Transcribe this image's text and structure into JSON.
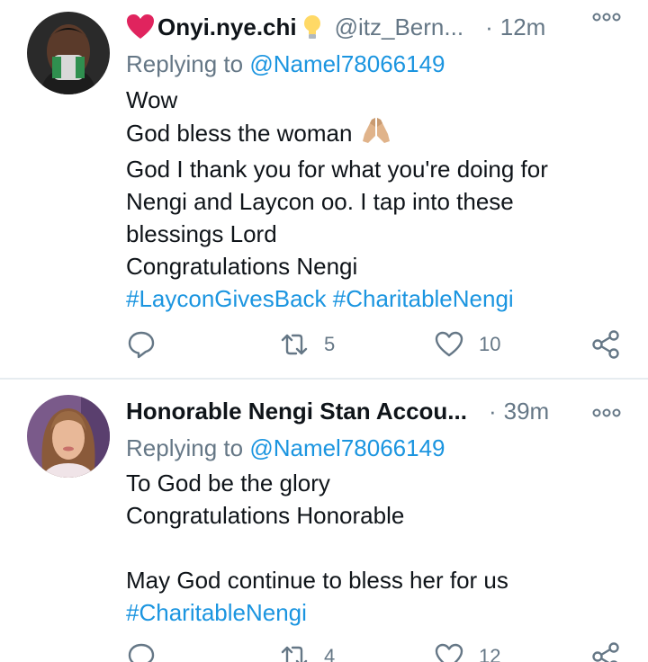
{
  "tweets": [
    {
      "display_name": "Onyi.nye.chi",
      "handle": "@itz_Bern...",
      "time": "12m",
      "replying_prefix": "Replying to ",
      "replying_to": "@Namel78066149",
      "lines": [
        "Wow",
        "God bless the woman",
        "God I thank you for what you're doing for",
        "Nengi and Laycon oo. I tap into these",
        "blessings Lord",
        "Congratulations Nengi"
      ],
      "hashtags": [
        "#LayconGivesBack",
        "#CharitableNengi"
      ],
      "replies": "",
      "retweets": "5",
      "likes": "10"
    },
    {
      "display_name": "Honorable Nengi Stan Accou...",
      "time": "39m",
      "replying_prefix": "Replying to ",
      "replying_to": "@Namel78066149",
      "lines": [
        "To God be the glory",
        "Congratulations Honorable",
        "",
        "May God continue to bless her for us"
      ],
      "hashtags": [
        "#CharitableNengi"
      ],
      "retweets": "4",
      "likes": "12"
    }
  ],
  "icons": {
    "emoji_heart": "red-heart-icon",
    "emoji_bulb": "light-bulb-icon",
    "emoji_pray": "folded-hands-icon",
    "reply": "reply-icon",
    "retweet": "retweet-icon",
    "like": "like-icon",
    "share": "share-icon",
    "more": "more-options-icon"
  },
  "colors": {
    "link": "#1b95e0",
    "secondary_text": "#657786",
    "heart_emoji": "#e0245e"
  }
}
